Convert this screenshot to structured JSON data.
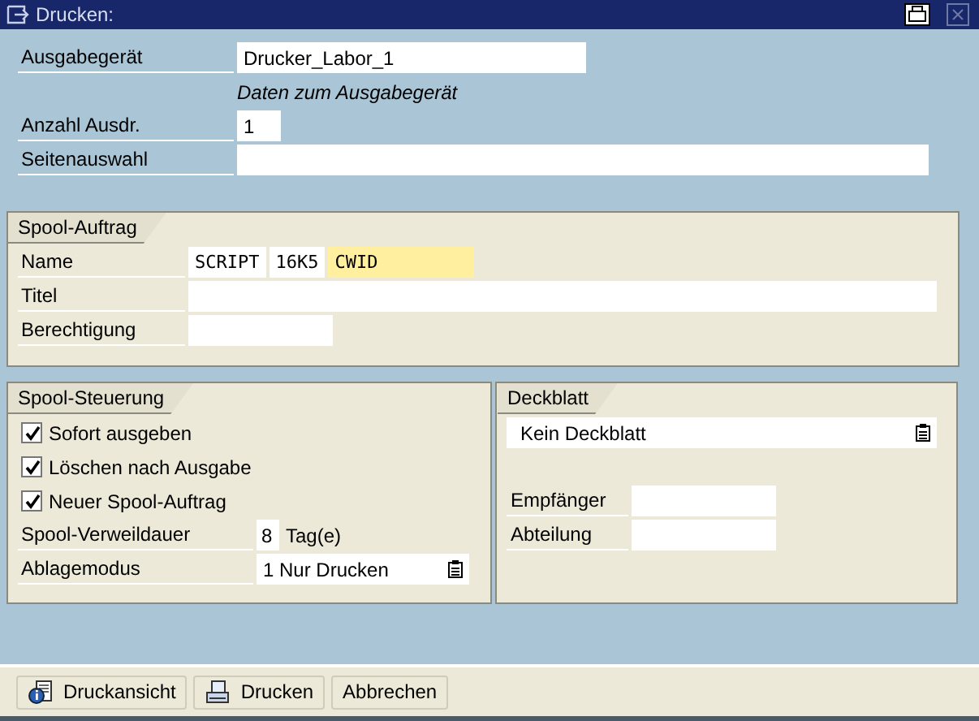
{
  "window": {
    "title": "Drucken:"
  },
  "device": {
    "label": "Ausgabegerät",
    "value": "Drucker_Labor_1",
    "note": "Daten zum Ausgabegerät"
  },
  "copies": {
    "label": "Anzahl Ausdr.",
    "value": "1"
  },
  "page_selection": {
    "label": "Seitenauswahl"
  },
  "spool_request": {
    "title": "Spool-Auftrag",
    "name": {
      "label": "Name",
      "parts": [
        {
          "text": "SCRIPT",
          "highlighted": false
        },
        {
          "text": "16K5",
          "highlighted": false
        },
        {
          "text": "CWID",
          "highlighted": true
        }
      ]
    },
    "title_field": {
      "label": "Titel"
    },
    "authorization": {
      "label": "Berechtigung"
    }
  },
  "spool_control": {
    "title": "Spool-Steuerung",
    "options": [
      {
        "label": "Sofort ausgeben",
        "checked": true
      },
      {
        "label": "Löschen nach Ausgabe",
        "checked": true
      },
      {
        "label": "Neuer Spool-Auftrag",
        "checked": true
      }
    ],
    "retention": {
      "label": "Spool-Verweildauer",
      "value": "8",
      "unit": "Tag(e)"
    },
    "storage_mode": {
      "label": "Ablagemodus",
      "value": "1 Nur Drucken"
    }
  },
  "cover_page": {
    "title": "Deckblatt",
    "value": "Kein Deckblatt",
    "recipient": {
      "label": "Empfänger"
    },
    "department": {
      "label": "Abteilung"
    }
  },
  "buttons": [
    {
      "label": "Druckansicht",
      "kind": "preview"
    },
    {
      "label": "Drucken",
      "kind": "print"
    },
    {
      "label": "Abbrechen",
      "kind": "plain"
    }
  ]
}
